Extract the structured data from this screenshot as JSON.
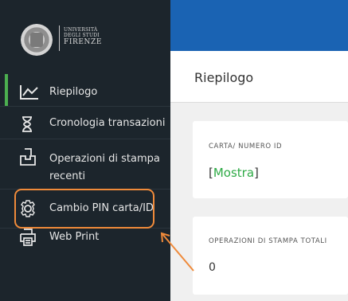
{
  "logo": {
    "line1": "UNIVERSITÀ",
    "line2": "DEGLI STUDI",
    "line3": "FIRENZE"
  },
  "sidebar": {
    "items": [
      {
        "label": "Riepilogo",
        "icon": "chart-line-icon",
        "active": true
      },
      {
        "label": "Cronologia transazioni",
        "icon": "hourglass-icon"
      },
      {
        "label": "Operazioni di stampa recenti",
        "label_line1": "Operazioni di stampa",
        "label_line2": "recenti",
        "icon": "printer-tray-icon"
      },
      {
        "label": "Cambio PIN carta/ID",
        "icon": "gear-icon",
        "highlighted": true
      },
      {
        "label": "Web Print",
        "icon": "printer-icon"
      }
    ]
  },
  "header": {
    "title": "Riepilogo"
  },
  "cards": {
    "card_id": {
      "caption": "CARTA/ NUMERO ID",
      "bracket_open": "[",
      "link": "Mostra",
      "bracket_close": "]"
    },
    "print_total": {
      "caption": "OPERAZIONI DI STAMPA TOTALI",
      "value": "0"
    }
  },
  "colors": {
    "sidebar_bg": "#1c252c",
    "topbar": "#1a63b3",
    "accent_green": "#4caf50",
    "highlight_orange": "#ef8a3a",
    "link_green": "#2eaa45"
  }
}
